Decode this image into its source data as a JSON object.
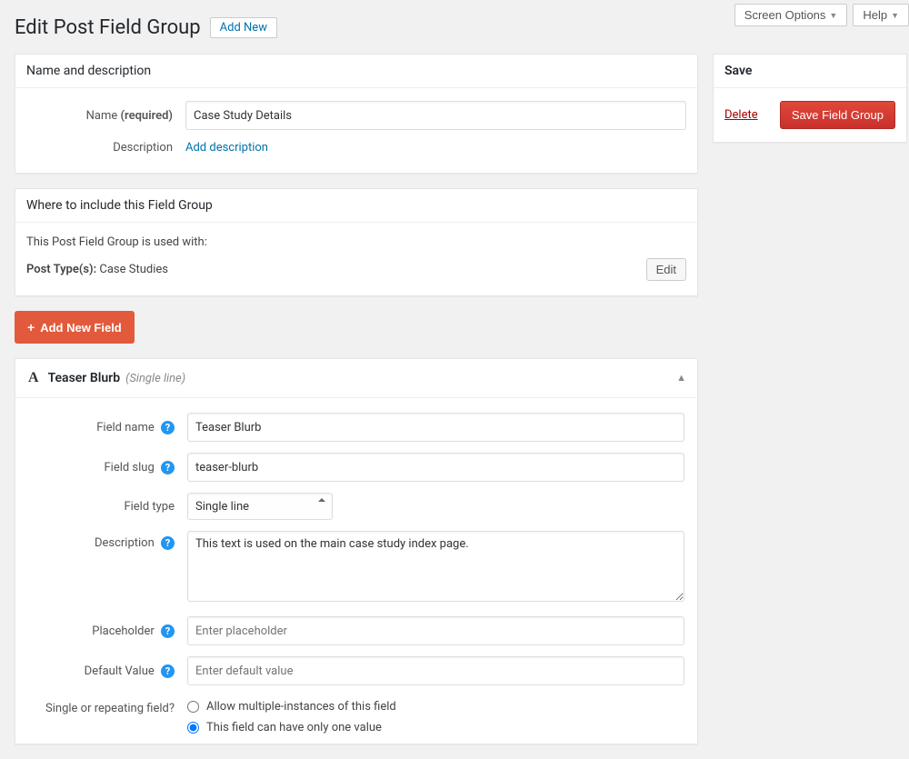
{
  "top": {
    "screen_options": "Screen Options",
    "help": "Help"
  },
  "page": {
    "title": "Edit Post Field Group",
    "add_new": "Add New"
  },
  "name_desc": {
    "heading": "Name and description",
    "name_label": "Name",
    "required": "(required)",
    "name_value": "Case Study Details",
    "desc_label": "Description",
    "add_desc": "Add description"
  },
  "where": {
    "heading": "Where to include this Field Group",
    "used_with": "This Post Field Group is used with:",
    "post_types_label": "Post Type(s):",
    "post_types_value": "Case Studies",
    "edit": "Edit"
  },
  "add_field_btn": "Add New Field",
  "field": {
    "head_name": "Teaser Blurb",
    "head_type": "(Single line)",
    "labels": {
      "name": "Field name",
      "slug": "Field slug",
      "type": "Field type",
      "desc": "Description",
      "placeholder": "Placeholder",
      "default": "Default Value",
      "repeating": "Single or repeating field?"
    },
    "values": {
      "name": "Teaser Blurb",
      "slug": "teaser-blurb",
      "type": "Single line",
      "desc": "This text is used on the main case study index page."
    },
    "placeholders": {
      "placeholder": "Enter placeholder",
      "default": "Enter default value"
    },
    "radio": {
      "multiple": "Allow multiple-instances of this field",
      "single": "This field can have only one value"
    }
  },
  "save": {
    "heading": "Save",
    "delete": "Delete",
    "button": "Save Field Group"
  }
}
